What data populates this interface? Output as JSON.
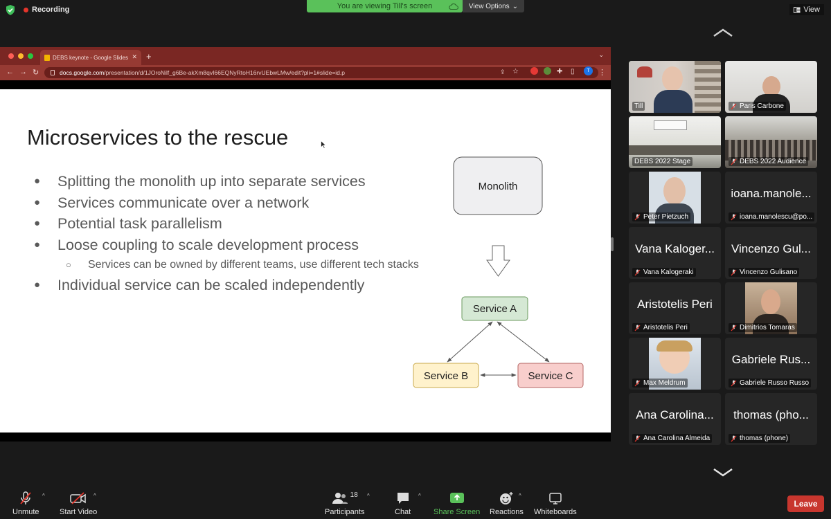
{
  "top": {
    "recording": "Recording",
    "banner": "You are viewing Till's screen",
    "view_options": "View Options",
    "view": "View"
  },
  "browser": {
    "tab_title": "DEBS keynote - Google Slides",
    "url_host": "docs.google.com",
    "url_path": "/presentation/d/1JOroNilf_g6Be-akXm8qvI66EQNyRtoH16rvUEbwLMw/edit?pli=1#slide=id.p",
    "profile_initial": "T"
  },
  "slide": {
    "title": "Microservices to the rescue",
    "bullets": [
      "Splitting the monolith up into separate services",
      "Services communicate over a network",
      "Potential task parallelism",
      "Loose coupling to scale development process",
      "Individual service can be scaled independently"
    ],
    "sub_bullet": "Services can be owned by different teams, use different tech stacks",
    "diagram": {
      "monolith": "Monolith",
      "service_a": "Service A",
      "service_b": "Service B",
      "service_c": "Service C"
    }
  },
  "participants": [
    {
      "name": "Till",
      "big": ""
    },
    {
      "name": "Paris Carbone",
      "big": ""
    },
    {
      "name": "DEBS 2022 Stage",
      "big": ""
    },
    {
      "name": "DEBS 2022 Audience",
      "big": ""
    },
    {
      "name": "Peter Pietzuch",
      "big": ""
    },
    {
      "name": "ioana.manolescu@po...",
      "big": "ioana.manole..."
    },
    {
      "name": "Vana Kalogeraki",
      "big": "Vana Kaloger..."
    },
    {
      "name": "Vincenzo Gulisano",
      "big": "Vincenzo Gul..."
    },
    {
      "name": "Aristotelis Peri",
      "big": "Aristotelis Peri"
    },
    {
      "name": "Dimitrios Tomaras",
      "big": ""
    },
    {
      "name": "Max Meldrum",
      "big": ""
    },
    {
      "name": "Gabriele Russo Russo",
      "big": "Gabriele Rus..."
    },
    {
      "name": "Ana Carolina Almeida",
      "big": "Ana Carolina..."
    },
    {
      "name": "thomas (phone)",
      "big": "thomas (pho..."
    }
  ],
  "toolbar": {
    "unmute": "Unmute",
    "start_video": "Start Video",
    "participants": "Participants",
    "participants_count": "18",
    "chat": "Chat",
    "share_screen": "Share Screen",
    "reactions": "Reactions",
    "whiteboards": "Whiteboards",
    "leave": "Leave"
  },
  "colors": {
    "share_green": "#5ac15a",
    "leave_red": "#c8362e",
    "browser_red": "#7a2723",
    "service_a": "#d5e8d4",
    "service_b": "#fff2cc",
    "service_c": "#f8cecc"
  }
}
